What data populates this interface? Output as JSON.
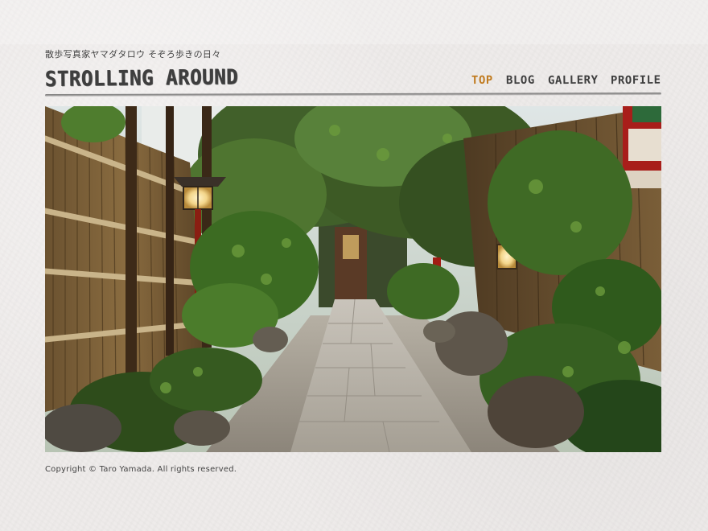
{
  "site": {
    "tagline": "散歩写真家ヤマダタロウ そぞろ歩きの日々",
    "title": "STROLLING AROUND"
  },
  "nav": {
    "items": [
      {
        "label": "TOP",
        "active": true
      },
      {
        "label": "BLOG",
        "active": false
      },
      {
        "label": "GALLERY",
        "active": false
      },
      {
        "label": "PROFILE",
        "active": false
      }
    ],
    "active_color": "#c07a1e",
    "text_color": "#3e3e3e"
  },
  "hero": {
    "description": "stone-path-alley-photo"
  },
  "footer": {
    "copyright": "Copyright © Taro Yamada. All rights reserved."
  },
  "colors": {
    "background": "#eeebea",
    "text": "#3a3a3a"
  }
}
